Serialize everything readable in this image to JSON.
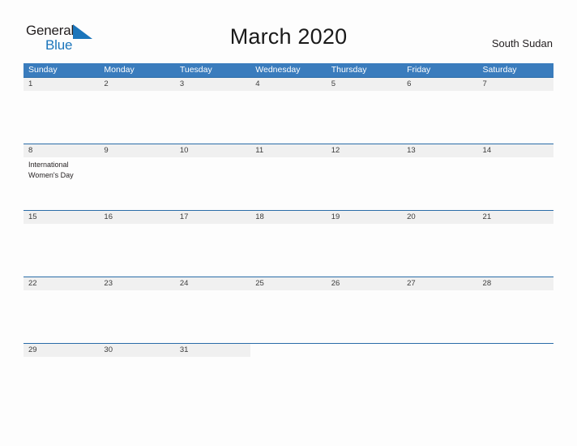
{
  "brand": {
    "name_part1": "General",
    "name_part2": "Blue",
    "flag_color": "#1b75bb",
    "text_color": "#231f20"
  },
  "header": {
    "title": "March 2020",
    "location": "South Sudan"
  },
  "colors": {
    "header_bar": "#3a7cbd",
    "row_divider": "#2a6ca8",
    "day_band": "#f0f0f0",
    "page_background": "#fdfdfd"
  },
  "calendar": {
    "month": "March",
    "year": "2020",
    "day_headers": [
      "Sunday",
      "Monday",
      "Tuesday",
      "Wednesday",
      "Thursday",
      "Friday",
      "Saturday"
    ],
    "weeks": [
      [
        {
          "day": "1",
          "events": []
        },
        {
          "day": "2",
          "events": []
        },
        {
          "day": "3",
          "events": []
        },
        {
          "day": "4",
          "events": []
        },
        {
          "day": "5",
          "events": []
        },
        {
          "day": "6",
          "events": []
        },
        {
          "day": "7",
          "events": []
        }
      ],
      [
        {
          "day": "8",
          "events": [
            "International Women's Day"
          ]
        },
        {
          "day": "9",
          "events": []
        },
        {
          "day": "10",
          "events": []
        },
        {
          "day": "11",
          "events": []
        },
        {
          "day": "12",
          "events": []
        },
        {
          "day": "13",
          "events": []
        },
        {
          "day": "14",
          "events": []
        }
      ],
      [
        {
          "day": "15",
          "events": []
        },
        {
          "day": "16",
          "events": []
        },
        {
          "day": "17",
          "events": []
        },
        {
          "day": "18",
          "events": []
        },
        {
          "day": "19",
          "events": []
        },
        {
          "day": "20",
          "events": []
        },
        {
          "day": "21",
          "events": []
        }
      ],
      [
        {
          "day": "22",
          "events": []
        },
        {
          "day": "23",
          "events": []
        },
        {
          "day": "24",
          "events": []
        },
        {
          "day": "25",
          "events": []
        },
        {
          "day": "26",
          "events": []
        },
        {
          "day": "27",
          "events": []
        },
        {
          "day": "28",
          "events": []
        }
      ],
      [
        {
          "day": "29",
          "events": []
        },
        {
          "day": "30",
          "events": []
        },
        {
          "day": "31",
          "events": []
        },
        {
          "day": "",
          "events": []
        },
        {
          "day": "",
          "events": []
        },
        {
          "day": "",
          "events": []
        },
        {
          "day": "",
          "events": []
        }
      ]
    ]
  }
}
